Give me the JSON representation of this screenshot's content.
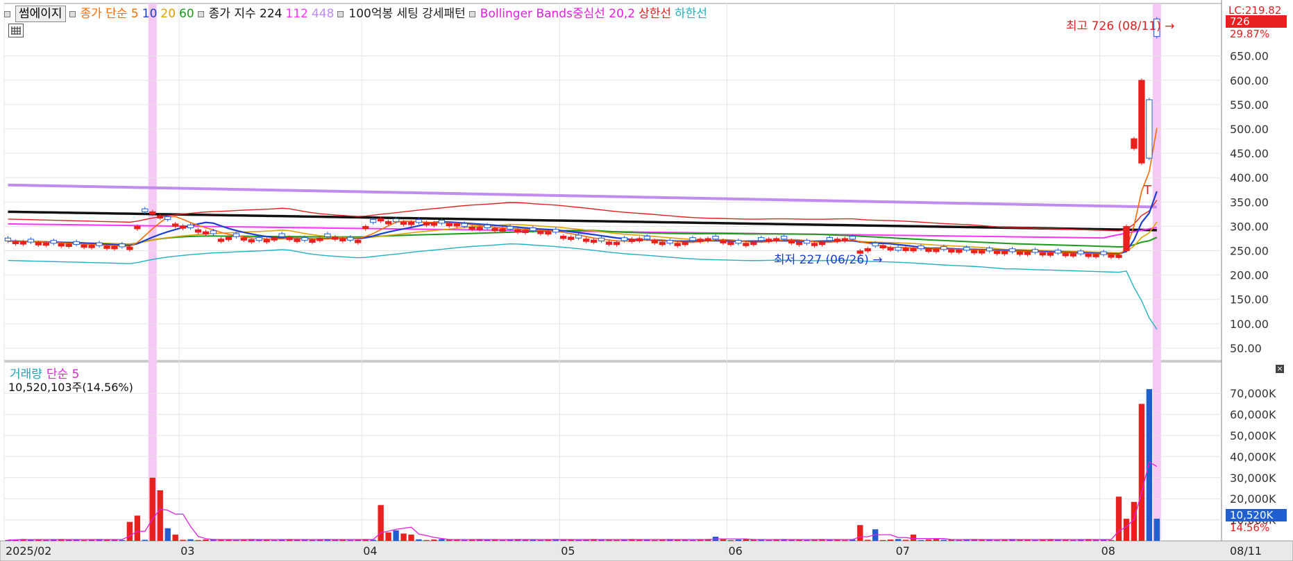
{
  "legend": {
    "btn": "썸에이지",
    "items": [
      {
        "text": "종가 단순 5",
        "color": "#ff6a00"
      },
      {
        "text": "10",
        "color": "#1a3fd0"
      },
      {
        "text": "20",
        "color": "#e0a000"
      },
      {
        "text": "60",
        "color": "#1c9a1c"
      },
      {
        "text": "종가 지수 224",
        "color": "#111111"
      },
      {
        "text": "112",
        "color": "#ff33ff"
      },
      {
        "text": "448",
        "color": "#c08cf0"
      },
      {
        "text": "100억봉 세팅 강세패턴",
        "color": "#222222"
      },
      {
        "text": "Bollinger Bands중심선 20,2",
        "color": "#e020e0"
      },
      {
        "text": "상한선",
        "color": "#e02020"
      },
      {
        "text": "하한선",
        "color": "#20b0c0"
      }
    ]
  },
  "volume_legend": {
    "label": "거래량",
    "ma": "단순 5",
    "info": "10,520,103주(14.56%)"
  },
  "right_top": {
    "lc": "LC:219.82",
    "last": "726",
    "pct": "29.87%"
  },
  "right_vol": {
    "last": "10,520K",
    "pct": "14.56%"
  },
  "bottom_right": "08/11",
  "annotations": {
    "high": "최고 726 (08/11)",
    "low": "최저 227 (06/26)",
    "t_marker": "T"
  },
  "colors": {
    "up": "#e8201e",
    "down": "#1f5fd0",
    "highlight": "#f6c8f4",
    "axis": "#888888"
  },
  "chart_data": {
    "type": "candlestick",
    "price_axis": {
      "min": 30,
      "max": 735,
      "ticks": [
        50,
        100,
        150,
        200,
        250,
        300,
        350,
        400,
        450,
        500,
        550,
        600,
        650
      ],
      "tick_labels": [
        "50.00",
        "100.00",
        "150.00",
        "200.00",
        "250.00",
        "300.00",
        "350.00",
        "400.00",
        "450.00",
        "500.00",
        "550.00",
        "600.00",
        "650.00"
      ]
    },
    "volume_axis": {
      "max": 75000,
      "ticks": [
        10000,
        20000,
        30000,
        40000,
        50000,
        60000,
        70000
      ],
      "tick_labels": [
        "10,000K",
        "20,000K",
        "30,000K",
        "40,000K",
        "50,000K",
        "60,000K",
        "70,000K"
      ]
    },
    "x_ticks": [
      "2025/02",
      "03",
      "04",
      "05",
      "06",
      "07",
      "08"
    ],
    "x_tick_index": [
      0,
      23,
      47,
      73,
      95,
      117,
      144
    ],
    "highlight_index": [
      19,
      151
    ],
    "high": {
      "value": 726,
      "date": "08/11"
    },
    "low": {
      "value": 227,
      "date": "06/26"
    }
  }
}
